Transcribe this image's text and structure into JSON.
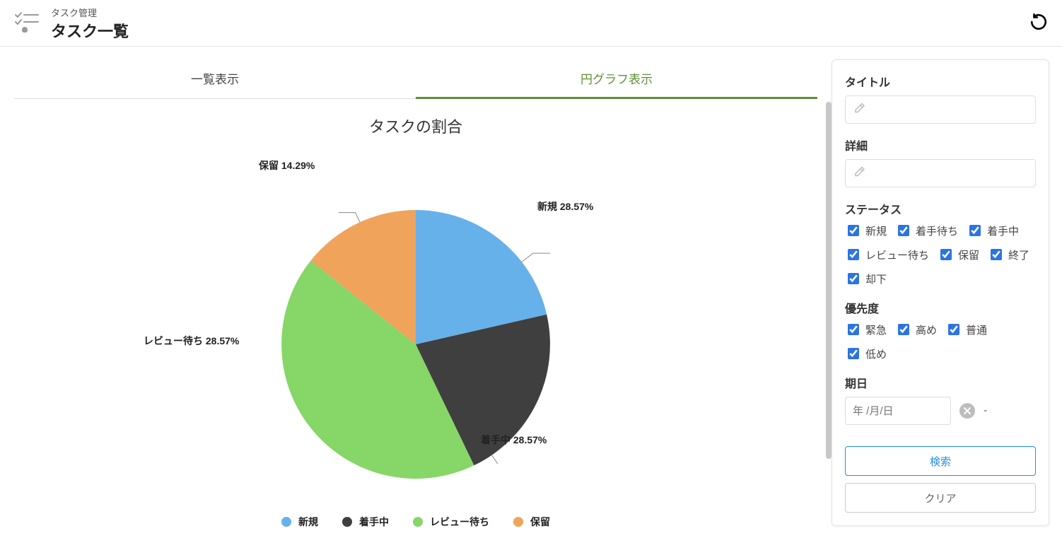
{
  "header": {
    "breadcrumb": "タスク管理",
    "title": "タスク一覧"
  },
  "tabs": {
    "list": "一覧表示",
    "pie": "円グラフ表示",
    "active": "pie"
  },
  "chart_data": {
    "type": "pie",
    "title": "タスクの割合",
    "series": [
      {
        "name": "新規",
        "value": 28.57,
        "label": "新規 28.57%",
        "color": "#67b1ea"
      },
      {
        "name": "着手中",
        "value": 28.57,
        "label": "着手中 28.57%",
        "color": "#3f3f3f"
      },
      {
        "name": "レビュー待ち",
        "value": 28.57,
        "label": "レビュー待ち 28.57%",
        "color": "#87d668"
      },
      {
        "name": "保留",
        "value": 14.29,
        "label": "保留 14.29%",
        "color": "#f0a35a"
      }
    ],
    "legend": [
      "新規",
      "着手中",
      "レビュー待ち",
      "保留"
    ]
  },
  "filters": {
    "title_label": "タイトル",
    "detail_label": "詳細",
    "status_label": "ステータス",
    "status_options": [
      "新規",
      "着手待ち",
      "着手中",
      "レビュー待ち",
      "保留",
      "終了",
      "却下"
    ],
    "priority_label": "優先度",
    "priority_options": [
      "緊急",
      "高め",
      "普通",
      "低め"
    ],
    "date_label": "期日",
    "date_placeholder": "年 /月/日",
    "date_separator": "-",
    "search_btn": "検索",
    "clear_btn": "クリア"
  }
}
